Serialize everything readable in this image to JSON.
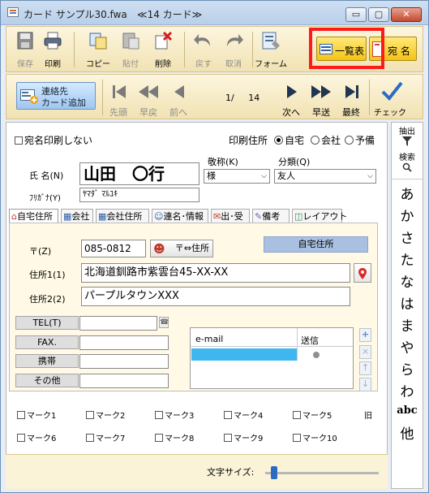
{
  "window": {
    "title": "カード サンプル30.fwa",
    "count_label": "≪14 カード≫",
    "minimize": "▭",
    "maximize": "▢",
    "close": "✕"
  },
  "toolbar": {
    "save": "保存",
    "print": "印刷",
    "copy": "コピー",
    "paste": "貼付",
    "delete": "削除",
    "undo": "戻す",
    "cancel": "取消",
    "form": "フォーム",
    "list": "一覧表",
    "address": "宛 名"
  },
  "nav": {
    "add_contact_l1": "連絡先",
    "add_contact_l2": "カード追加",
    "first": "先頭",
    "fast_back": "早戻",
    "prev": "前へ",
    "page_current": "1/",
    "page_total": "14",
    "next": "次へ",
    "fast_forward": "早送",
    "last": "最終",
    "check": "チェック"
  },
  "form": {
    "no_print_label": "宛名印刷しない",
    "print_address_label": "印刷住所",
    "radio_home": "自宅",
    "radio_company": "会社",
    "radio_spare": "予備",
    "name_label": "氏 名(N)",
    "name_value": "山田　〇行",
    "furigana_label": "ﾌﾘｶﾞﾅ(Y)",
    "furigana_value": "ﾔﾏﾀﾞ ﾏﾙﾕｷ",
    "honorific_label": "敬称(K)",
    "honorific_value": "様",
    "category_label": "分類(Q)",
    "category_value": "友人"
  },
  "tabs": [
    "自宅住所",
    "会社",
    "会社住所",
    "連名･情報",
    "出･受",
    "備考",
    "レイアウト"
  ],
  "address": {
    "zip_label": "〒(Z)",
    "zip_value": "085-0812",
    "zip_button": "〒⇔住所",
    "home_badge": "自宅住所",
    "addr1_label": "住所1(1)",
    "addr1_value": "北海道釧路市紫雲台45-XX-XX",
    "addr2_label": "住所2(2)",
    "addr2_value": "パープルタウンXXX"
  },
  "phones": {
    "tel": "TEL(T)",
    "fax": "FAX.",
    "mobile": "携帯",
    "other": "その他"
  },
  "email": {
    "col_email": "e-mail",
    "col_send": "送信"
  },
  "marks": [
    "マーク1",
    "マーク2",
    "マーク3",
    "マーク4",
    "マーク5",
    "マーク6",
    "マーク7",
    "マーク8",
    "マーク9",
    "マーク10"
  ],
  "marks_extra": "旧",
  "footer": {
    "font_size_label": "文字サイズ:",
    "font_size_level": 0.05
  },
  "index": {
    "top_label": "抽出",
    "search_label": "検索",
    "kana": [
      "あ",
      "か",
      "さ",
      "た",
      "な",
      "は",
      "ま",
      "や",
      "ら",
      "わ"
    ],
    "abc": "abc",
    "other": "他"
  }
}
